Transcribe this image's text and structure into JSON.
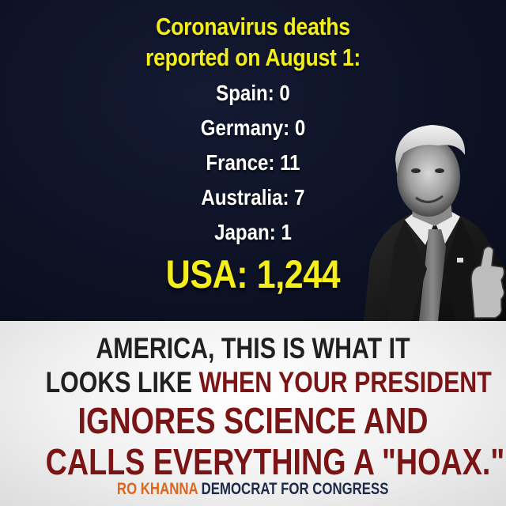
{
  "headline": {
    "line1": "Coronavirus deaths",
    "line2": "reported on August 1:"
  },
  "stats": [
    {
      "label": "Spain: 0"
    },
    {
      "label": "Germany: 0"
    },
    {
      "label": "France: 11"
    },
    {
      "label": "Australia: 7"
    },
    {
      "label": "Japan: 1"
    }
  ],
  "usa": {
    "label": "USA: 1,244"
  },
  "message": {
    "line1": "AMERICA, THIS IS WHAT IT",
    "line2_dark": "LOOKS LIKE",
    "line2_red": "WHEN YOUR PRESIDENT",
    "line3": "IGNORES SCIENCE AND",
    "line4": "CALLS EVERYTHING A \"HOAX.\""
  },
  "footer": {
    "name": "RO KHANNA",
    "title": "DEMOCRAT FOR CONGRESS"
  },
  "colors": {
    "dark_background": "#0e1225",
    "headline_yellow": "#f4ef1a",
    "stat_white": "#ffffff",
    "message_dark": "#202020",
    "message_red": "#7b1414",
    "footer_orange": "#e0651d",
    "footer_navy": "#1e2a48"
  },
  "portrait": {
    "icon": "man-thumbs-up-photo"
  }
}
